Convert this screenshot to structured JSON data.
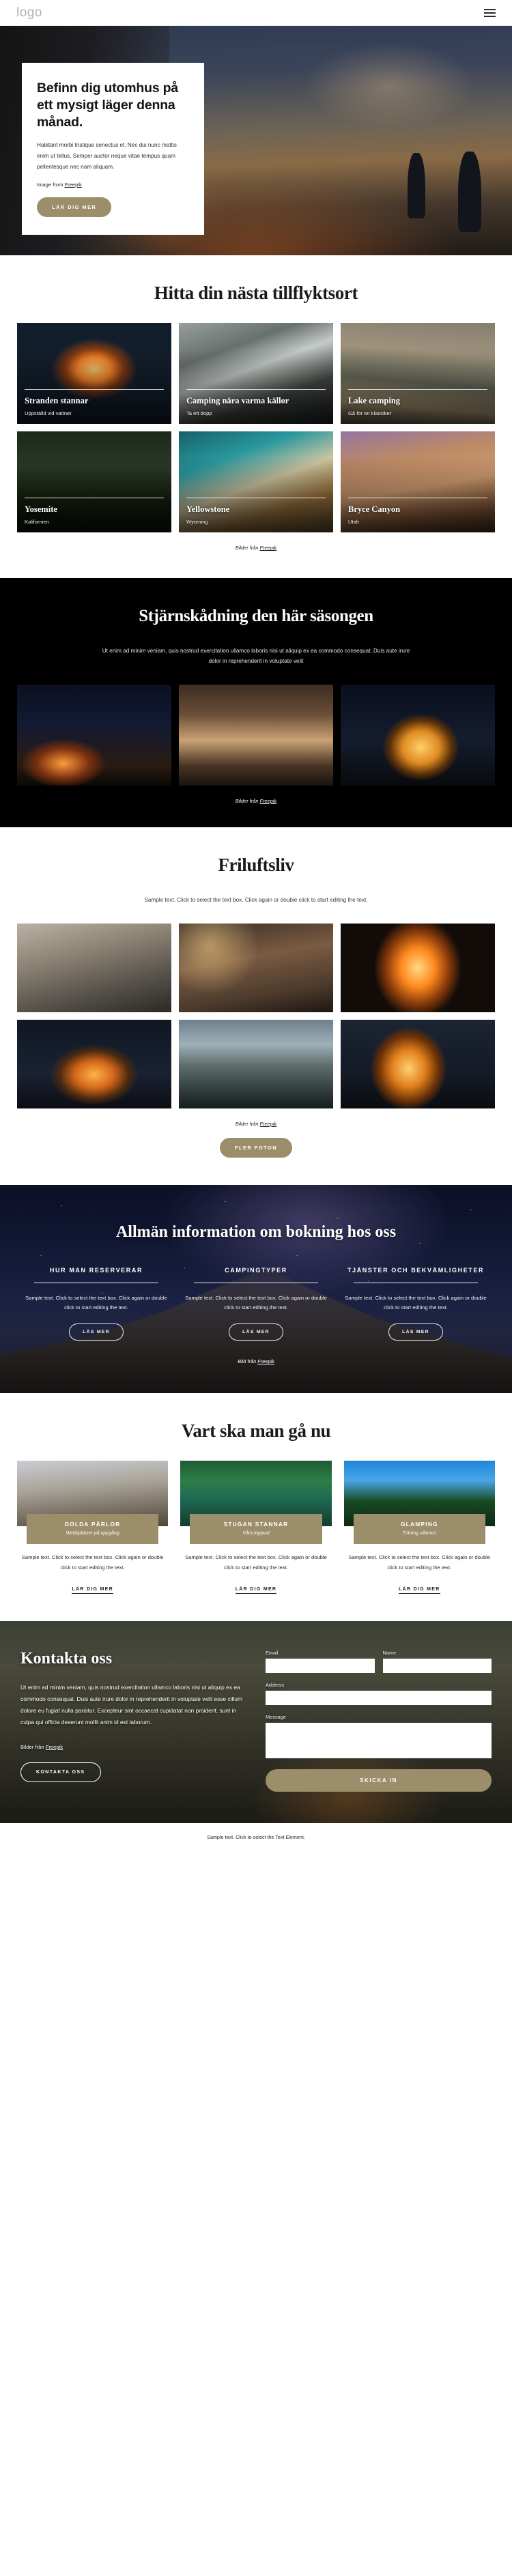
{
  "header": {
    "logo": "logo",
    "menu_icon": "hamburger-menu-icon"
  },
  "hero": {
    "title": "Befinn dig utomhus på ett mysigt läger denna månad.",
    "body": "Habitant morbi tristique senectus et. Nec dui nunc mattis enim ut tellus. Semper auctor neque vitae tempus quam pellentesque nec nam aliquam.",
    "credit_prefix": "Image from ",
    "credit_link": "Freepik",
    "cta": "LÄR DIG MER"
  },
  "destinations": {
    "title": "Hitta din nästa tillflyktsort",
    "credit_prefix": "Bilder från ",
    "credit_link": "Freepik",
    "cards": [
      {
        "name": "Stranden stannar",
        "sub": "Uppställd vid vattnet",
        "bg": "bg-bonfire"
      },
      {
        "name": "Camping nära varma källor",
        "sub": "Ta ett dopp",
        "bg": "bg-falls"
      },
      {
        "name": "Lake camping",
        "sub": "Gå för en klassiker",
        "bg": "bg-lake"
      },
      {
        "name": "Yosemite",
        "sub": "Kalifornien",
        "bg": "bg-yosemite"
      },
      {
        "name": "Yellowstone",
        "sub": "Wyoming",
        "bg": "bg-yellow"
      },
      {
        "name": "Bryce Canyon",
        "sub": "Utah",
        "bg": "bg-bryce"
      }
    ]
  },
  "stargazing": {
    "title": "Stjärnskådning den här säsongen",
    "body": "Ut enim ad minim veniam, quis nostrud exercitation ullamco laboris nisi ut aliquip ex ea commodo consequat. Duis aute irure dolor in reprehenderit in voluptate velit",
    "credit_prefix": "Bilder från ",
    "credit_link": "Freepik",
    "images": [
      "bg-night1",
      "bg-night2",
      "bg-night3"
    ]
  },
  "outdoor": {
    "title": "Friluftsliv",
    "body": "Sample text. Click to select the text box. Click again or double click to start editing the text.",
    "credit_prefix": "Bilder från ",
    "credit_link": "Freepik",
    "cta": "FLER FOTON",
    "images": [
      "bg-f1",
      "bg-f2",
      "bg-f3",
      "bg-f4",
      "bg-f5",
      "bg-f6"
    ]
  },
  "booking": {
    "title": "Allmän information om bokning hos oss",
    "credit_prefix": "Bild från ",
    "credit_link": "Freepik",
    "columns": [
      {
        "heading": "HUR MAN RESERVERAR",
        "body": "Sample text. Click to select the text box. Click again or double click to start editing the text.",
        "cta": "LÄS MER"
      },
      {
        "heading": "CAMPINGTYPER",
        "body": "Sample text. Click to select the text box. Click again or double click to start editing the text.",
        "cta": "LÄS MER"
      },
      {
        "heading": "TJÄNSTER OCH BEKVÄMLIGHETER",
        "body": "Sample text. Click to select the text box. Click again or double click to start editing the text.",
        "cta": "LÄS MER"
      }
    ]
  },
  "where_to_go": {
    "title": "Vart ska man gå nu",
    "cards": [
      {
        "badge_title": "DOLDA PÄRLOR",
        "badge_sub": "Webbplatser på uppgång",
        "body": "Sample text. Click to select the text box. Click again or double click to start editing the text.",
        "link": "LÄR DIG MER",
        "bg": "bg-g1"
      },
      {
        "badge_title": "STUGAN STANNAR",
        "badge_sub": "Våra toppval",
        "body": "Sample text. Click to select the text box. Click again or double click to start editing the text.",
        "link": "LÄR DIG MER",
        "bg": "bg-g2b"
      },
      {
        "badge_title": "GLAMPING",
        "badge_sub": "Träning ullamco",
        "body": "Sample text. Click to select the text box. Click again or double click to start editing the text.",
        "link": "LÄR DIG MER",
        "bg": "bg-g3"
      }
    ]
  },
  "contact": {
    "title": "Kontakta oss",
    "body": "Ut enim ad minim veniam, quis nostrud exercitation ullamco laboris nisi ut aliquip ex ea commodo consequat. Duis aute irure dolor in reprehenderit in voluptate velit esse cillum dolore eu fugiat nulla pariatur. Excepteur sint occaecat cupidatat non proident, sunt in culpa qui officia deserunt mollit anim id est laborum.",
    "credit_prefix": "Bilder från ",
    "credit_link": "Freepik",
    "cta": "KONTAKTA OSS",
    "form": {
      "email_label": "Email",
      "email_value": "",
      "name_label": "Name",
      "name_value": "",
      "address_label": "Address",
      "address_value": "",
      "message_label": "Message",
      "message_value": "",
      "submit": "SKICKA IN"
    }
  },
  "footer": {
    "text": "Sample text. Click to select the Text Element."
  },
  "colors": {
    "accent": "#9c8e6a",
    "dark": "#000000",
    "night": "#141a38"
  }
}
